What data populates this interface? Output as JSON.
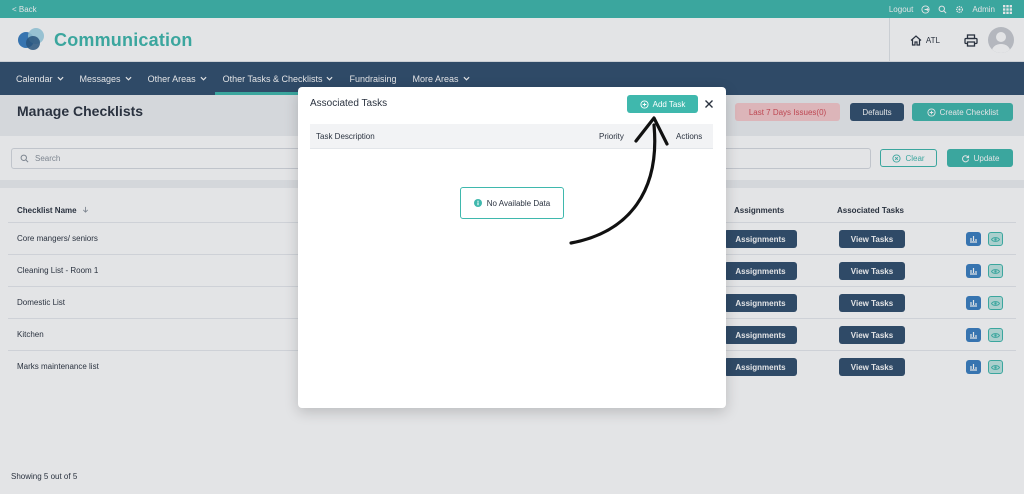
{
  "topbar": {
    "back": "< Back",
    "logout": "Logout",
    "admin": "Admin"
  },
  "header": {
    "brand": "Communication",
    "location": "ATL"
  },
  "nav": {
    "items": [
      "Calendar",
      "Messages",
      "Other Areas",
      "Other Tasks & Checklists",
      "Fundraising",
      "More Areas"
    ]
  },
  "page": {
    "title": "Manage Checklists",
    "issues_label": "Last 7 Days Issues(0)",
    "defaults_label": "Defaults",
    "create_label": "Create Checklist"
  },
  "filter": {
    "search_placeholder": "Search",
    "clear_label": "Clear",
    "update_label": "Update"
  },
  "table": {
    "columns": {
      "name": "Checklist Name",
      "assignments": "Assignments",
      "tasks": "Associated Tasks"
    },
    "rows": [
      {
        "name": "Core mangers/ seniors",
        "assign": "Assignments",
        "view": "View Tasks"
      },
      {
        "name": "Cleaning List - Room 1",
        "assign": "Assignments",
        "view": "View Tasks"
      },
      {
        "name": "Domestic List",
        "assign": "Assignments",
        "view": "View Tasks"
      },
      {
        "name": "Kitchen",
        "assign": "Assignments",
        "view": "View Tasks"
      },
      {
        "name": "Marks maintenance list",
        "assign": "Assignments",
        "view": "View Tasks"
      }
    ],
    "footer": "Showing 5 out of 5"
  },
  "modal": {
    "title": "Associated Tasks",
    "add_label": "Add Task",
    "columns": {
      "description": "Task Description",
      "priority": "Priority",
      "actions": "Actions"
    },
    "empty": "No Available Data"
  },
  "colors": {
    "teal": "#3fb8ad",
    "navy": "#314f6e",
    "issues": "#d44b55"
  },
  "icons": [
    "logout-icon",
    "search-icon",
    "gear-icon",
    "grid-icon",
    "home-icon",
    "print-icon",
    "chevron-down-icon",
    "sort-icon",
    "plus-circle-icon",
    "refresh-icon",
    "chart-icon",
    "eye-icon",
    "info-icon",
    "close-icon"
  ]
}
